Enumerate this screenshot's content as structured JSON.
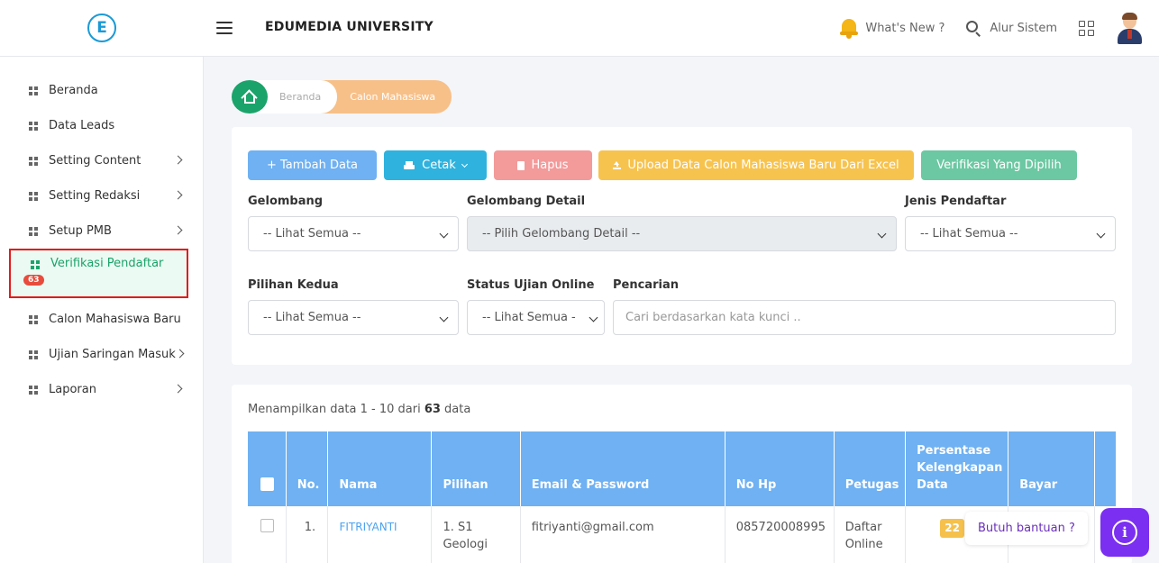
{
  "header": {
    "logo_letter": "E",
    "title": "EDUMEDIA UNIVERSITY",
    "whats_new": "What's New ?",
    "alur_sistem": "Alur Sistem"
  },
  "sidebar": {
    "items": [
      {
        "label": "Beranda",
        "chevron": false
      },
      {
        "label": "Data Leads",
        "chevron": false
      },
      {
        "label": "Setting Content",
        "chevron": true
      },
      {
        "label": "Setting Redaksi",
        "chevron": true
      },
      {
        "label": "Setup PMB",
        "chevron": true
      },
      {
        "label": "Verifikasi Pendaftar",
        "chevron": false,
        "active": true,
        "badge": "63"
      },
      {
        "label": "Calon Mahasiswa Baru",
        "chevron": false
      },
      {
        "label": "Ujian Saringan Masuk",
        "chevron": true
      },
      {
        "label": "Laporan",
        "chevron": true
      }
    ]
  },
  "breadcrumb": {
    "home": "Beranda",
    "current": "Calon Mahasiswa"
  },
  "toolbar": {
    "tambah": "+ Tambah Data",
    "cetak": "Cetak",
    "hapus": "Hapus",
    "upload": "Upload Data Calon Mahasiswa Baru Dari Excel",
    "verifikasi": "Verifikasi Yang Dipilih"
  },
  "filters": {
    "gelombang": {
      "label": "Gelombang",
      "value": "-- Lihat Semua --"
    },
    "gelombang_detail": {
      "label": "Gelombang Detail",
      "value": "-- Pilih Gelombang Detail --"
    },
    "jenis_pendaftar": {
      "label": "Jenis Pendaftar",
      "value": "-- Lihat Semua --"
    },
    "pilihan_kedua": {
      "label": "Pilihan Kedua",
      "value": "-- Lihat Semua --"
    },
    "status_ujian": {
      "label": "Status Ujian Online",
      "value": "-- Lihat Semua -"
    },
    "pencarian": {
      "label": "Pencarian",
      "placeholder": "Cari berdasarkan kata kunci .."
    }
  },
  "table": {
    "summary_prefix": "Menampilkan data 1 - 10 dari ",
    "summary_total": "63",
    "summary_suffix": " data",
    "headers": {
      "no": "No.",
      "nama": "Nama",
      "pilihan": "Pilihan",
      "email": "Email & Password",
      "hp": "No Hp",
      "petugas": "Petugas",
      "persentase": "Persentase Kelengkapan Data",
      "bayar": "Bayar"
    },
    "rows": [
      {
        "no": "1.",
        "nama": "FITRIYANTI",
        "pilihan": "1. S1 Geologi",
        "email": "fitriyanti@gmail.com",
        "hp": "085720008995",
        "petugas": "Daftar Online",
        "persentase": "22"
      }
    ]
  },
  "help": {
    "label": "Butuh bantuan ?",
    "icon": "i"
  },
  "colors": {
    "primary_green": "#1aa36a",
    "header_blue": "#6fb1f2",
    "accent_purple": "#7b2ff0",
    "active_outline": "#e21b1b"
  }
}
